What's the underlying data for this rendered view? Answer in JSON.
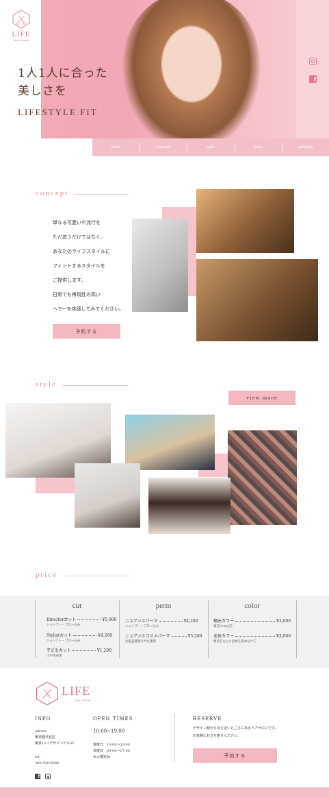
{
  "brand": {
    "name": "LIFE",
    "tagline": "hair design"
  },
  "hero": {
    "headline_1": "1人1人に合った",
    "headline_2": "美しさを",
    "subline": "LIFESTYLE FIT"
  },
  "nav": {
    "items": [
      "home",
      "concept",
      "style",
      "price",
      "salondata"
    ]
  },
  "social": {
    "instagram": "instagram-icon",
    "facebook": "facebook-icon"
  },
  "concept": {
    "title": "concept",
    "lines": [
      "単なる可愛いや流行を",
      "ただ追うだけではなく、",
      "あなたのライフスタイルに",
      "フィットするスタイルを",
      "ご提供します。",
      "日常でも再現性の高い",
      "ヘアーを体感してみてください。"
    ],
    "button": "予約する"
  },
  "style": {
    "title": "style",
    "button": "view more"
  },
  "price": {
    "title": "price",
    "columns": [
      {
        "heading": "cut",
        "items": [
          {
            "name": "Directorカット",
            "price": "¥5,000",
            "note": "シャンプー・ブロー込み"
          },
          {
            "name": "Stylistカット",
            "price": "¥4,200",
            "note": "シャンプー・ブロー込み"
          },
          {
            "name": "子どもカット",
            "price": "¥1,200",
            "note": "小学生未満"
          }
        ]
      },
      {
        "heading": "perm",
        "items": [
          {
            "name": "ニュアンスパーマ",
            "price": "¥4,200",
            "note": "シャンプー・ブロー込み"
          },
          {
            "name": "ニュアンスコスメパーマ",
            "price": "¥5,200",
            "note": "化粧品登録された薬剤"
          }
        ]
      },
      {
        "heading": "color",
        "items": [
          {
            "name": "根元カラー",
            "price": "¥3,000",
            "note": "根元2cm以内"
          },
          {
            "name": "全体カラー",
            "price": "¥3,000",
            "note": "根元をもとに全体を染め分けて"
          }
        ]
      }
    ]
  },
  "footer": {
    "info_title": "INFO",
    "address_label": "adress.",
    "address_1": "東京都渋谷区",
    "address_2": "東京12-3デザインビル3F",
    "tel_label": "tel.",
    "tel": "000-000-0000",
    "hours_title": "OPEN TIMES",
    "hours_main": "10:00~19:00",
    "hours_1": "金曜日　10:00～20:00",
    "hours_2": "日曜日　09:00～17:00",
    "holiday": "水火曜定休",
    "reserve_title": "RESERVE",
    "reserve_text_1": "デザイン駅からほど近いところにあるヘアサロンです。",
    "reserve_text_2": "お気軽にお立ち寄りください。",
    "reserve_button": "予約する"
  },
  "colors": {
    "accent": "#f4b8c1",
    "brand": "#e8788a"
  }
}
